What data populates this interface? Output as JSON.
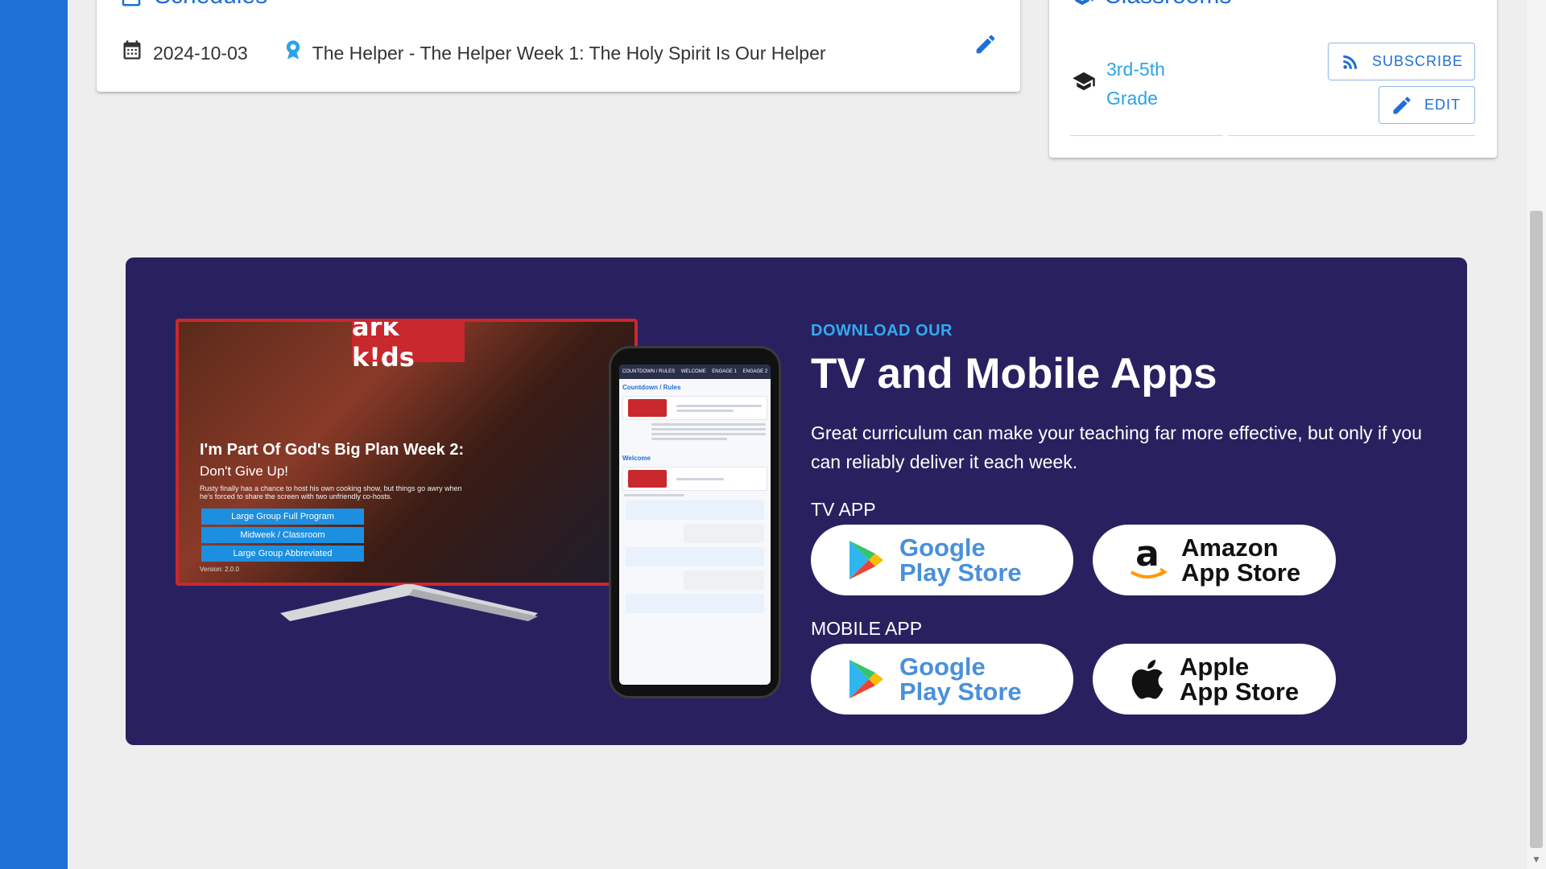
{
  "schedules": {
    "title": "Schedules",
    "add_label": "+",
    "row": {
      "date": "2024-10-03",
      "lesson": "The Helper - The Helper Week 1: The Holy Spirit Is Our Helper"
    }
  },
  "classrooms": {
    "title": "Classrooms",
    "add_label": "+",
    "item": "3rd-5th Grade",
    "subscribe_label": "SUBSCRIBE",
    "edit_label": "EDIT"
  },
  "banner": {
    "eyebrow": "DOWNLOAD OUR",
    "title": "TV and Mobile Apps",
    "description": "Great curriculum can make your teaching far more effective, but only if you can reliably deliver it each week.",
    "tv_app_label": "TV APP",
    "mobile_app_label": "MOBILE APP",
    "google_store_line1": "Google",
    "google_store_line2": "Play Store",
    "amazon_store_line1": "Amazon",
    "amazon_store_line2": "App Store",
    "apple_store_line1": "Apple",
    "apple_store_line2": "App Store"
  },
  "tv_preview": {
    "logo": "ark k!ds",
    "title": "I'm Part Of God's Big Plan Week 2:",
    "subtitle": "Don't Give Up!",
    "description": "Rusty finally has a chance to host his own cooking show, but things go awry when he's forced to share the screen with two unfriendly co-hosts.",
    "buttons": [
      "Large Group Full Program",
      "Midweek / Classroom",
      "Large Group Abbreviated"
    ],
    "version": "Version: 2.0.0"
  },
  "phone_preview": {
    "tabs": [
      "COUNTDOWN / RULES",
      "WELCOME",
      "ENGAGE 1",
      "ENGAGE 2"
    ],
    "section1": "Countdown / Rules",
    "section2": "Welcome"
  },
  "colors": {
    "brand_blue": "#1e6fd6",
    "banner_bg": "#29215f",
    "accent_light_blue": "#33aaf0"
  }
}
